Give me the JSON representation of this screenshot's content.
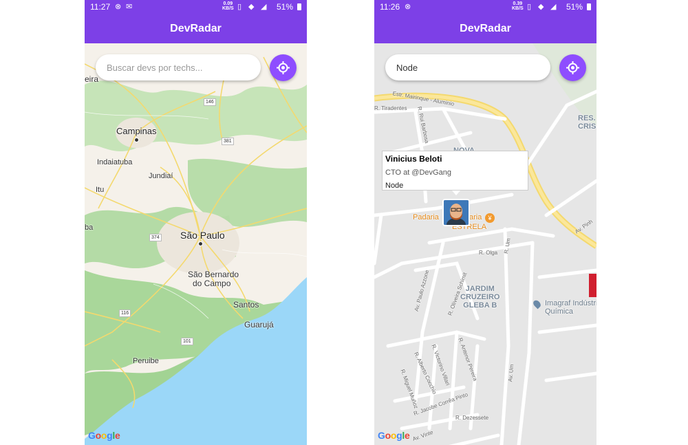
{
  "left": {
    "status": {
      "time": "11:27",
      "speed_value": "0.09",
      "speed_unit": "KB/S",
      "battery": "51%"
    },
    "title": "DevRadar",
    "search": {
      "value": "",
      "placeholder": "Buscar devs por techs..."
    },
    "map": {
      "places": [
        "Campinas",
        "Indaiatuba",
        "Jundiaí",
        "São Paulo",
        "São Bernardo",
        "do Campo",
        "Santos",
        "Guarujá",
        "Peruibe",
        "Itu",
        "eira",
        "ba"
      ],
      "routes": [
        "146",
        "381",
        "374",
        "116",
        "101"
      ],
      "attribution": "Google"
    }
  },
  "right": {
    "status": {
      "time": "11:26",
      "speed_value": "0.39",
      "speed_unit": "KB/S",
      "battery": "51%"
    },
    "title": "DevRadar",
    "search": {
      "value": "Node",
      "placeholder": "Buscar devs por techs..."
    },
    "map": {
      "streets": [
        "Estr. Mairinque - Aluminio",
        "R. Tiradentes",
        "R. Rui Barbosa",
        "Av. Pinh",
        "R. Olga",
        "R. Um",
        "Av. Paulo Azzone",
        "R. Oliveira Schimit",
        "R. Antenor Pereira",
        "R. Victorino Villari",
        "R. Alberto Cocchio",
        "R. Miguel Muñoz",
        "R. Jacobe Corrêa Pinto",
        "R. Dezessete",
        "Av. Um",
        "Av. Vinte"
      ],
      "poi_padaria": "Padaria",
      "poi_padaria_suffix": "aria",
      "poi_estrela": "ESTRELA",
      "neighborhood": [
        "JARDIM",
        "CRUZEIRO",
        "GLEBA B"
      ],
      "neighborhood_top": "NOVA",
      "res_label": [
        "RES. I",
        "CRIS"
      ],
      "imagraf": [
        "Imagraf Indústria",
        "Química"
      ],
      "attribution": "Google"
    },
    "callout": {
      "name": "Vinicius Beloti",
      "bio": "CTO at @DevGang",
      "techs": "Node"
    }
  },
  "colors": {
    "accent": "#7d40e7",
    "button": "#8e4dff",
    "water": "#9bd7f8",
    "forest": "#b7dfae",
    "highway": "#f4d96e"
  }
}
